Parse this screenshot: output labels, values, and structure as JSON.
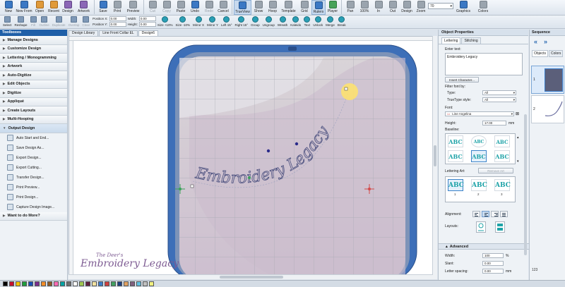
{
  "toolbar": {
    "buttons": [
      {
        "label": "New",
        "icon": "new-file-icon",
        "color": "blue"
      },
      {
        "label": "New From",
        "icon": "new-from-icon",
        "color": "blue"
      },
      {
        "label": "Open",
        "icon": "open-folder-icon",
        "color": "orange"
      },
      {
        "label": "Recent",
        "icon": "recent-files-icon",
        "color": "orange"
      },
      {
        "label": "Design",
        "icon": "design-icon",
        "color": "purple"
      },
      {
        "label": "Artwork",
        "icon": "artwork-icon",
        "color": "purple"
      },
      {
        "label": "Save",
        "icon": "save-icon",
        "color": "blue"
      },
      {
        "label": "Print",
        "icon": "print-icon",
        "color": "gray"
      },
      {
        "label": "Preview",
        "icon": "print-preview-icon",
        "color": "gray"
      },
      {
        "label": "Cut",
        "icon": "cut-icon",
        "color": "gray",
        "disabled": true
      },
      {
        "label": "Copy",
        "icon": "copy-icon",
        "color": "gray",
        "disabled": true
      },
      {
        "label": "Paste",
        "icon": "paste-icon",
        "color": "gray"
      },
      {
        "label": "Undo",
        "icon": "undo-icon",
        "color": "blue"
      },
      {
        "label": "Redo",
        "icon": "redo-icon",
        "color": "gray",
        "disabled": true
      },
      {
        "label": "Cancel",
        "icon": "cancel-icon",
        "color": "gray"
      },
      {
        "label": "TrueView",
        "icon": "trueview-icon",
        "color": "blue",
        "active": true
      },
      {
        "label": "Show",
        "icon": "show-icon",
        "color": "gray"
      },
      {
        "label": "Hoop",
        "icon": "hoop-icon",
        "color": "gray"
      },
      {
        "label": "Template",
        "icon": "template-icon",
        "color": "gray"
      },
      {
        "label": "Grid",
        "icon": "grid-icon",
        "color": "gray"
      },
      {
        "label": "Rulers",
        "icon": "rulers-icon",
        "color": "blue",
        "active": true
      },
      {
        "label": "Player",
        "icon": "player-icon",
        "color": "green"
      },
      {
        "label": "Pan",
        "icon": "pan-icon",
        "color": "gray"
      },
      {
        "label": "100%",
        "icon": "zoom-100-icon",
        "color": "gray"
      },
      {
        "label": "In",
        "icon": "zoom-in-icon",
        "color": "gray"
      },
      {
        "label": "Out",
        "icon": "zoom-out-icon",
        "color": "gray"
      },
      {
        "label": "Design",
        "icon": "zoom-design-icon",
        "color": "gray"
      },
      {
        "label": "Zoom",
        "icon": "zoom-icon",
        "color": "gray"
      }
    ],
    "zoom_value": "70",
    "right_buttons": [
      {
        "label": "Graphics",
        "icon": "graphics-icon",
        "color": "blue"
      },
      {
        "label": "Colors",
        "icon": "colors-icon",
        "color": "gray"
      }
    ]
  },
  "subtoolbar": {
    "left_buttons": [
      {
        "label": "Select",
        "icon": "select-arrow-icon"
      },
      {
        "label": "Reshape",
        "icon": "reshape-icon"
      },
      {
        "label": "Fill",
        "icon": "fill-icon",
        "disabled": true
      },
      {
        "label": "Outline",
        "icon": "outline-icon",
        "disabled": true
      },
      {
        "label": "Duplicate",
        "icon": "duplicate-icon",
        "disabled": true
      },
      {
        "label": "Overlap",
        "icon": "overlap-icon",
        "disabled": true
      },
      {
        "label": "Clear",
        "icon": "clear-icon",
        "disabled": true
      }
    ],
    "position_x_label": "Position X:",
    "position_x": "0.00",
    "position_y_label": "Position Y:",
    "position_y": "0.00",
    "width_label": "Width:",
    "width": "0.00",
    "height_label": "Height:",
    "height": "0.00",
    "transform_buttons": [
      {
        "label": "Size +10%"
      },
      {
        "label": "Size -10%"
      },
      {
        "label": "Mirror X"
      },
      {
        "label": "Mirror Y"
      },
      {
        "label": "Left 15°"
      },
      {
        "label": "Right 15°"
      },
      {
        "label": "Group"
      },
      {
        "label": "Ungroup"
      },
      {
        "label": "Wreath"
      },
      {
        "label": "Kaleido"
      },
      {
        "label": "Text"
      },
      {
        "label": "Unlock"
      },
      {
        "label": "Merge"
      },
      {
        "label": "Break"
      }
    ]
  },
  "toolbox": {
    "title": "Toolboxes",
    "sections": [
      {
        "label": "Manage Designs"
      },
      {
        "label": "Customize Design"
      },
      {
        "label": "Lettering / Monogramming"
      },
      {
        "label": "Artwork"
      },
      {
        "label": "Auto-Digitize"
      },
      {
        "label": "Edit Objects"
      },
      {
        "label": "Digitize"
      },
      {
        "label": "Appliqué"
      },
      {
        "label": "Create Layouts"
      },
      {
        "label": "Multi-Hooping"
      }
    ],
    "open_section": "Output Design",
    "items": [
      {
        "label": "Auto Start and End..."
      },
      {
        "label": "Save Design As..."
      },
      {
        "label": "Export Design..."
      },
      {
        "label": "Export Cutting..."
      },
      {
        "label": "Transfer Design..."
      },
      {
        "label": "Print Preview..."
      },
      {
        "label": "Print Design..."
      },
      {
        "label": "Capture Design Image..."
      }
    ],
    "last_section": "Want to do More?"
  },
  "doc_tabs": [
    {
      "label": "Design Library"
    },
    {
      "label": "Line Front Collar EL"
    },
    {
      "label": "Design6",
      "active": true
    }
  ],
  "canvas": {
    "embroidery_text": "Embroidery Legacy",
    "thread_color": "#4a4f7e",
    "hoop_color": "#3d6fb8",
    "handle_color": "#ffe36b"
  },
  "watermark": {
    "small": "The Deer's",
    "big": "Embroidery Legacy"
  },
  "object_properties": {
    "title": "Object Properties",
    "tabs": [
      {
        "label": "Lettering",
        "active": true
      },
      {
        "label": "Stitching"
      }
    ],
    "enter_text_label": "Enter text:",
    "text_value": "Embroidery Legacy",
    "insert_char_label": "Insert Character...",
    "filter_label": "Filter font by:",
    "type_label": "Type:",
    "type_value": "All",
    "truetype_label": "TrueType style:",
    "truetype_value": "All",
    "font_label": "Font:",
    "font_value": "Line Angelina",
    "height_label": "Height:",
    "height_value": "17.00",
    "height_unit": "mm",
    "baseline_label": "Baseline:",
    "lettering_art_label": "Lettering Art:",
    "remove_art_label": "Remove Art",
    "gallery_numbers": [
      "1",
      "2",
      "3"
    ],
    "alignment_label": "Alignment:",
    "layouts_label": "Layouts:",
    "advanced_label": "Advanced",
    "width_label": "Width:",
    "width_value": "100",
    "width_unit": "%",
    "slant_label": "Slant:",
    "slant_value": "0.00",
    "letter_spacing_label": "Letter spacing:",
    "letter_spacing_value": "0.00",
    "letter_spacing_unit": "mm"
  },
  "sequence": {
    "title": "Sequence",
    "tabs": [
      {
        "label": "Objects",
        "active": true
      },
      {
        "label": "Colors"
      }
    ],
    "items": [
      {
        "num": "1"
      },
      {
        "num": "2"
      }
    ],
    "bottom_text": "123"
  },
  "palette": {
    "colors": [
      "#000000",
      "#c8102e",
      "#f2c200",
      "#1f9e3c",
      "#1b4fb5",
      "#7b2d8e",
      "#f28c28",
      "#8b5a2b",
      "#ff69b4",
      "#00a3a3",
      "#6f6f6f",
      "#ffffff",
      "#a0c850",
      "#602040",
      "#f2e2a0",
      "#3a7cc8",
      "#d04040",
      "#40a060",
      "#204080",
      "#e0a060",
      "#806080",
      "#60c0e0",
      "#c0c0c0",
      "#f0f080"
    ]
  }
}
